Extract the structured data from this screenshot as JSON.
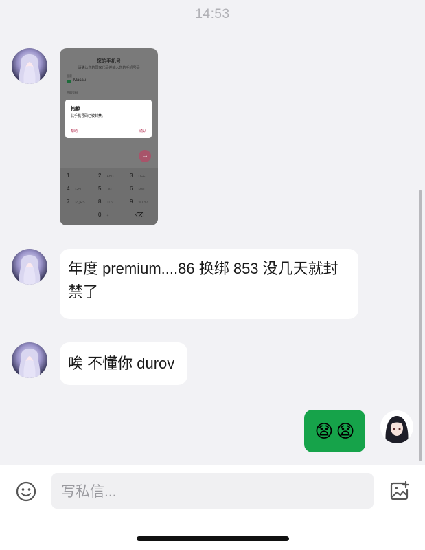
{
  "header": {
    "time": "14:53"
  },
  "messages": [
    {
      "type": "image",
      "sender": "other",
      "content": {
        "title": "您的手机号",
        "subtitle": "请确认您的国家代码并输入您的手机号码",
        "country_label": "国家",
        "country_value": "Macau",
        "phone_label": "手机号码",
        "dialog_title": "抱歉",
        "dialog_message": "此手机号码已被封禁。",
        "dialog_help": "帮助",
        "dialog_ok": "确认",
        "keys": [
          {
            "num": "1",
            "letters": ""
          },
          {
            "num": "2",
            "letters": "ABC"
          },
          {
            "num": "3",
            "letters": "DEF"
          },
          {
            "num": "4",
            "letters": "GHI"
          },
          {
            "num": "5",
            "letters": "JKL"
          },
          {
            "num": "6",
            "letters": "MNO"
          },
          {
            "num": "7",
            "letters": "PQRS"
          },
          {
            "num": "8",
            "letters": "TUV"
          },
          {
            "num": "9",
            "letters": "WXYZ"
          },
          {
            "num": "0",
            "letters": "+"
          }
        ]
      }
    },
    {
      "type": "text",
      "sender": "other",
      "text": "年度 premium....86 换绑 853 没几天就封禁了"
    },
    {
      "type": "text",
      "sender": "other",
      "text": "唉 不懂你 durov"
    },
    {
      "type": "emoji",
      "sender": "me",
      "emoji": [
        "😧",
        "😧"
      ]
    }
  ],
  "composer": {
    "placeholder": "写私信..."
  },
  "icons": {
    "emoji": "smiley-icon",
    "image": "image-plus-icon"
  },
  "colors": {
    "my_bubble": "#16a34a",
    "background": "#f2f2f5"
  }
}
